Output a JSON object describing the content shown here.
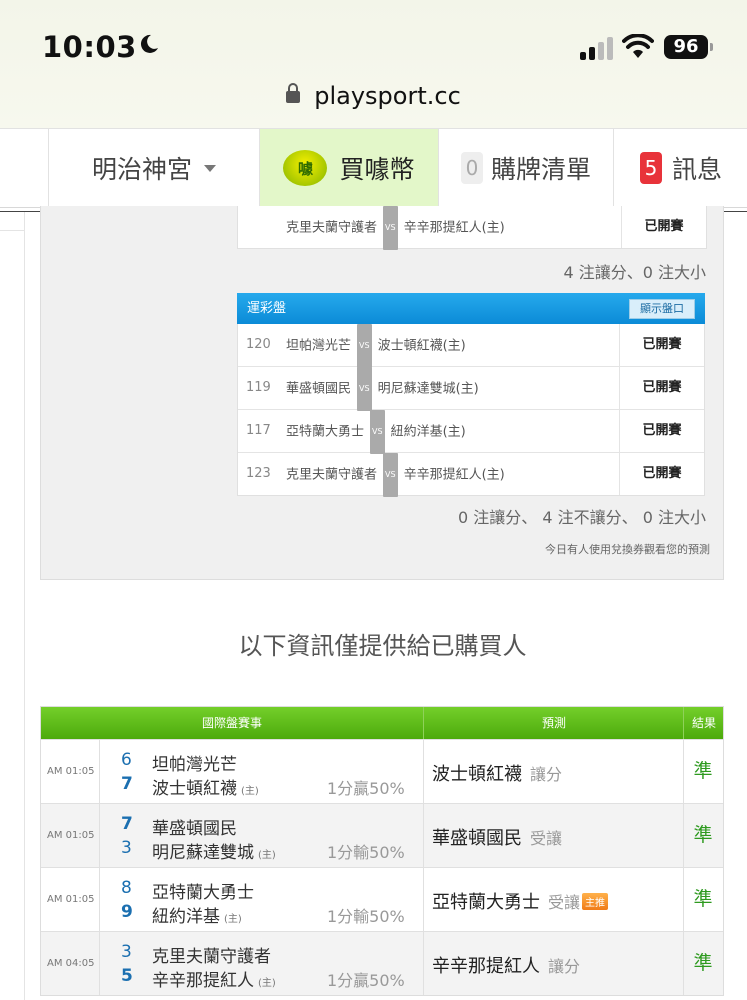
{
  "status_bar": {
    "time": "10:03",
    "battery": "96"
  },
  "browser": {
    "url": "playsport.cc"
  },
  "nav": {
    "menu_label": "明治神宮",
    "buy_coin_label": "買噱幣",
    "coin_icon_text": "噱",
    "purchase_count": "0",
    "purchase_list_label": "購牌清單",
    "message_count": "5",
    "message_label": "訊息"
  },
  "top_table": {
    "rows": [
      {
        "home": "克里夫蘭守護者",
        "away": "辛辛那提紅人(主)",
        "result": "已開賽"
      }
    ],
    "summary": "4 注讓分、0 注大小"
  },
  "lottery_table": {
    "title": "運彩盤",
    "show_button": "顯示盤口",
    "vs": "VS",
    "rows": [
      {
        "id": "120",
        "home": "坦帕灣光芒",
        "away": "波士頓紅襪(主)",
        "result": "已開賽"
      },
      {
        "id": "119",
        "home": "華盛頓國民",
        "away": "明尼蘇達雙城(主)",
        "result": "已開賽"
      },
      {
        "id": "117",
        "home": "亞特蘭大勇士",
        "away": "紐約洋基(主)",
        "result": "已開賽"
      },
      {
        "id": "123",
        "home": "克里夫蘭守護者",
        "away": "辛辛那提紅人(主)",
        "result": "已開賽"
      }
    ],
    "summary": "0 注讓分、 4 注不讓分、 0 注大小",
    "note": "今日有人使用兌換券觀看您的預測"
  },
  "banner": "以下資訊僅提供給已購買人",
  "games_table": {
    "headers": {
      "event": "國際盤賽事",
      "prediction": "預測",
      "result": "結果"
    },
    "home_tag": "(主)",
    "rows": [
      {
        "time": "AM 01:05",
        "score1": "6",
        "team1": "坦帕灣光芒",
        "score2": "7",
        "team2": "波士頓紅襪",
        "odds": "1分贏50%",
        "pick": "波士頓紅襪",
        "pick_type": "讓分",
        "badge": "",
        "result": "準"
      },
      {
        "time": "AM 01:05",
        "score1": "7",
        "team1": "華盛頓國民",
        "score2": "3",
        "team2": "明尼蘇達雙城",
        "odds": "1分輸50%",
        "pick": "華盛頓國民",
        "pick_type": "受讓",
        "badge": "",
        "result": "準"
      },
      {
        "time": "AM 01:05",
        "score1": "8",
        "team1": "亞特蘭大勇士",
        "score2": "9",
        "team2": "紐約洋基",
        "odds": "1分輸50%",
        "pick": "亞特蘭大勇士",
        "pick_type": "受讓",
        "badge": "主推",
        "result": "準"
      },
      {
        "time": "AM 04:05",
        "score1": "3",
        "team1": "克里夫蘭守護者",
        "score2": "5",
        "team2": "辛辛那提紅人",
        "odds": "1分贏50%",
        "pick": "辛辛那提紅人",
        "pick_type": "讓分",
        "badge": "",
        "result": "準"
      }
    ]
  }
}
